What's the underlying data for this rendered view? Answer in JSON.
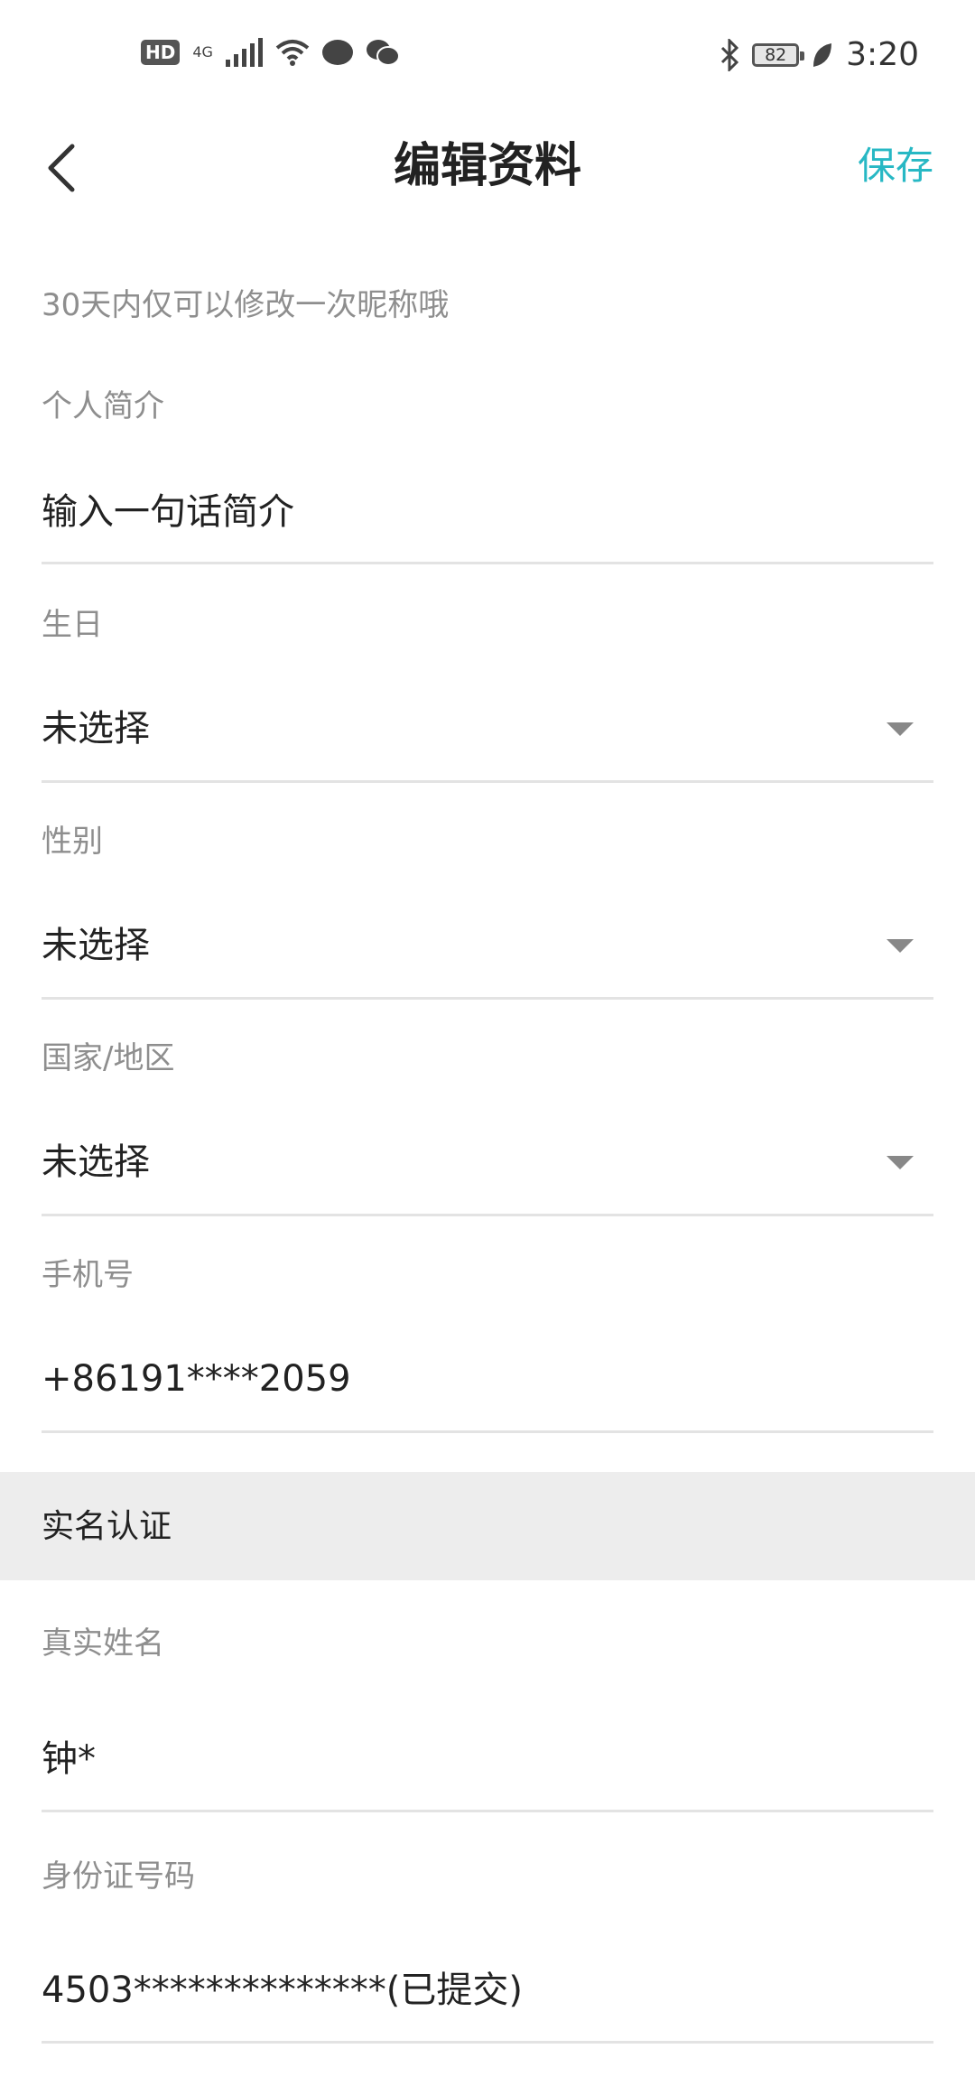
{
  "status_bar": {
    "hd_badge": "HD",
    "network": "4G",
    "battery": "82",
    "time": "3:20",
    "icons": [
      "signal-icon",
      "wifi-icon",
      "message-icon",
      "wechat-icon",
      "bluetooth-icon",
      "battery-icon",
      "leaf-icon"
    ]
  },
  "nav": {
    "title": "编辑资料",
    "save_label": "保存",
    "back_icon": "back-arrow-icon"
  },
  "hint": "30天内仅可以修改一次昵称哦",
  "fields": {
    "bio": {
      "label": "个人简介",
      "placeholder": "输入一句话简介"
    },
    "birthday": {
      "label": "生日",
      "value": "未选择"
    },
    "gender": {
      "label": "性别",
      "value": "未选择"
    },
    "region": {
      "label": "国家/地区",
      "value": "未选择"
    },
    "phone": {
      "label": "手机号",
      "value": "+86191****2059"
    }
  },
  "verification": {
    "title": "实名认证",
    "real_name": {
      "label": "真实姓名",
      "value": "钟*"
    },
    "id_number": {
      "label": "身份证号码",
      "value": "4503**************(已提交)"
    }
  },
  "colors": {
    "accent": "#27b8c4",
    "label": "#8e8e8e",
    "divider": "#e3e3e3",
    "section_bg": "#ededed"
  }
}
